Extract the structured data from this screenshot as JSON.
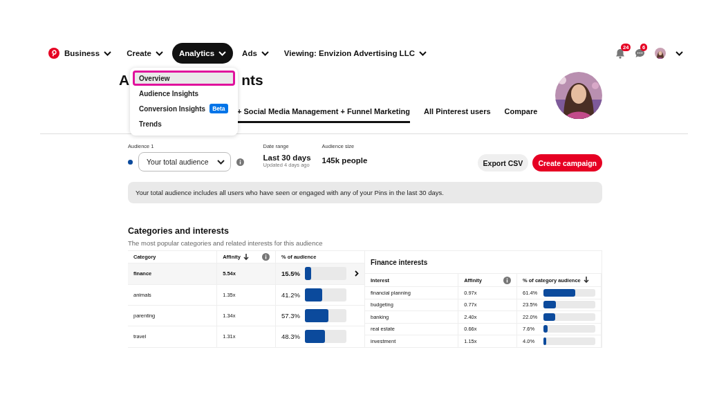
{
  "nav": {
    "items": [
      {
        "label": "Business",
        "selected": false
      },
      {
        "label": "Create",
        "selected": false
      },
      {
        "label": "Analytics",
        "selected": true
      },
      {
        "label": "Ads",
        "selected": false
      },
      {
        "label": "Viewing: Envizion Advertising LLC",
        "selected": false
      }
    ],
    "notifications_badge": "24",
    "messages_badge": "6"
  },
  "menu": {
    "items": [
      {
        "label": "Overview",
        "selected": true
      },
      {
        "label": "Audience Insights",
        "selected": false
      },
      {
        "label": "Conversion Insights",
        "selected": false,
        "badge": "Beta"
      },
      {
        "label": "Trends",
        "selected": false
      }
    ]
  },
  "title_parts": [
    "A",
    "nts"
  ],
  "tabs": [
    {
      "label": "+ Social Media Management + Funnel Marketing",
      "selected": true
    },
    {
      "label": "All Pinterest users",
      "selected": false
    },
    {
      "label": "Compare",
      "selected": false
    }
  ],
  "audience": {
    "label": "Audience 1",
    "color": "#0b4a9c",
    "value": "Your total audience"
  },
  "date_range": {
    "label": "Date range",
    "value": "Last 30 days",
    "note": "Updated 4 days ago"
  },
  "audience_size": {
    "label": "Audience size",
    "value": "145k people"
  },
  "buttons": [
    "Export CSV",
    "Create campaign"
  ],
  "info": "Your total audience includes all users who have seen or engaged with any of your Pins in the last 30 days.",
  "categories": {
    "title": "Categories and interests",
    "subtitle": "The most popular categories and related interests for this audience",
    "columns": [
      "Category",
      "Affinity",
      "% of audience"
    ],
    "rows": [
      {
        "name": "finance",
        "affinity": "5.54x",
        "percent": "15.5%",
        "level": 0.155,
        "selected": true
      },
      {
        "name": "animals",
        "affinity": "1.35x",
        "percent": "41.2%",
        "level": 0.412,
        "selected": false
      },
      {
        "name": "parenting",
        "affinity": "1.34x",
        "percent": "57.3%",
        "level": 0.573,
        "selected": false
      },
      {
        "name": "travel",
        "affinity": "1.31x",
        "percent": "48.3%",
        "level": 0.483,
        "selected": false
      }
    ]
  },
  "interests": {
    "title": "Finance interests",
    "columns": [
      "Interest",
      "Affinity",
      "% of category audience"
    ],
    "rows": [
      {
        "name": "financial planning",
        "affinity": "0.97x",
        "percent": "61.4%",
        "level": 0.614
      },
      {
        "name": "budgeting",
        "affinity": "0.77x",
        "percent": "23.5%",
        "level": 0.235
      },
      {
        "name": "banking",
        "affinity": "2.40x",
        "percent": "22.0%",
        "level": 0.22
      },
      {
        "name": "real estate",
        "affinity": "0.66x",
        "percent": "7.6%",
        "level": 0.076
      },
      {
        "name": "investment",
        "affinity": "1.15x",
        "percent": "4.0%",
        "level": 0.04
      }
    ]
  }
}
